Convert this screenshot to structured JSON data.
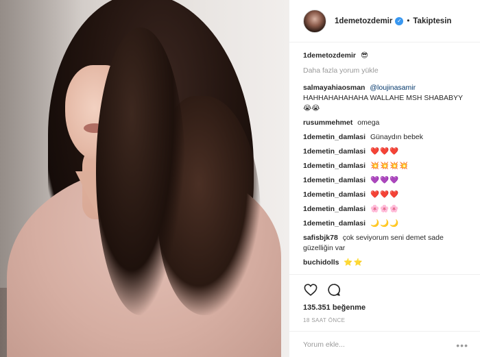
{
  "header": {
    "username": "1demetozdemir",
    "verified_mark": "✓",
    "separator": "•",
    "follow_status": "Takiptesin"
  },
  "caption": {
    "user": "1demetozdemir",
    "emoji": "😎"
  },
  "load_more": "Daha fazla yorum yükle",
  "comments": [
    {
      "user": "salmayahiaosman",
      "mention": "@loujinasamir",
      "text": "HAHHAHAHAHAHA WALLAHE MSH SHABABYY😭😭"
    },
    {
      "user": "rusummehmet",
      "text": "omega"
    },
    {
      "user": "1demetin_damlasi",
      "text": "Günaydın bebek"
    },
    {
      "user": "1demetin_damlasi",
      "text": "❤️❤️❤️"
    },
    {
      "user": "1demetin_damlasi",
      "text": "💥💥💥💥"
    },
    {
      "user": "1demetin_damlasi",
      "text": "💜💜💜"
    },
    {
      "user": "1demetin_damlasi",
      "text": "❤️❤️❤️"
    },
    {
      "user": "1demetin_damlasi",
      "text": "🌸🌸🌸"
    },
    {
      "user": "1demetin_damlasi",
      "text": "🌙🌙🌙"
    },
    {
      "user": "safisbjk78",
      "text": "çok seviyorum seni demet sade güzelliğin var"
    },
    {
      "user": "buchidolls",
      "text": "⭐⭐"
    }
  ],
  "actions": {
    "likes": "135.351 beğenme",
    "timestamp": "18 SAAT ÖNCE"
  },
  "add_comment": {
    "placeholder": "Yorum ekle...",
    "more": "•••"
  },
  "icons": [
    "heart-icon",
    "comment-icon"
  ]
}
